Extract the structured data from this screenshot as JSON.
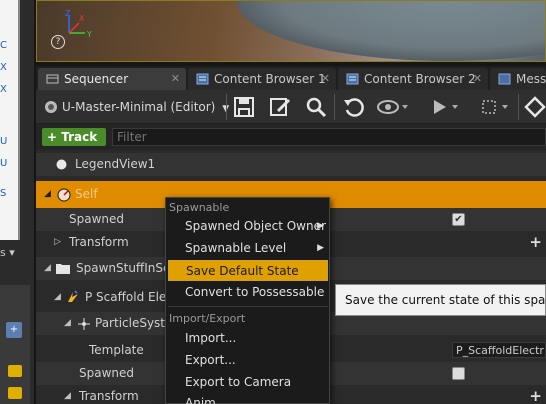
{
  "left": {
    "chars": [
      "C",
      "X",
      "X",
      "U",
      "U",
      "S"
    ],
    "dropdown": "s ▾",
    "add_badge": "+"
  },
  "viewport": {
    "axis_z": "Z",
    "axis_x": "X",
    "axis_y": "Y",
    "help": "?"
  },
  "tabs": [
    {
      "label": "Sequencer",
      "icon": "sequencer-icon",
      "active": true
    },
    {
      "label": "Content Browser 1",
      "icon": "content-browser-icon",
      "active": false
    },
    {
      "label": "Content Browser 2",
      "icon": "content-browser-icon",
      "active": false
    },
    {
      "label": "Mess",
      "icon": "message-log-icon",
      "active": false
    }
  ],
  "tab_close_glyph": "✕",
  "toolbar": {
    "sequence_name": "U-Master-Minimal (Editor)",
    "icons": [
      "save-icon",
      "save-as-icon",
      "find-icon",
      "undo-icon",
      "visibility-icon",
      "play-icon",
      "selection-icon",
      "key-icon"
    ]
  },
  "filter": {
    "track_label": "+ Track ▾",
    "placeholder": "Filter"
  },
  "tree": {
    "rows": [
      {
        "label": "LegendView1"
      },
      {
        "label": "Self"
      },
      {
        "label": "Spawned"
      },
      {
        "label": "Transform"
      },
      {
        "label": "SpawnStuffInSeq"
      },
      {
        "label": "P Scaffold Elec"
      },
      {
        "label": "ParticleSystem"
      },
      {
        "label": "Template"
      },
      {
        "label": "Spawned"
      },
      {
        "label": "Transform"
      }
    ],
    "template_value": "P_ScaffoldElectr",
    "plus_glyph": "+",
    "check_glyph": "✔"
  },
  "context_menu": {
    "section_spawnable": "Spawnable",
    "item_owner": "Spawned Object Owner",
    "item_level": "Spawnable Level",
    "item_save_default": "Save Default State",
    "item_convert": "Convert to Possessable",
    "section_import": "Import/Export",
    "item_import": "Import...",
    "item_export": "Export...",
    "item_export_camera": "Export to Camera Anim..."
  },
  "tooltip": {
    "text": "Save the current state of this spawnab"
  },
  "colors": {
    "selected_row": "#e08c00",
    "menu_highlight": "#e0a000",
    "track_button": "#4a8c2a"
  }
}
